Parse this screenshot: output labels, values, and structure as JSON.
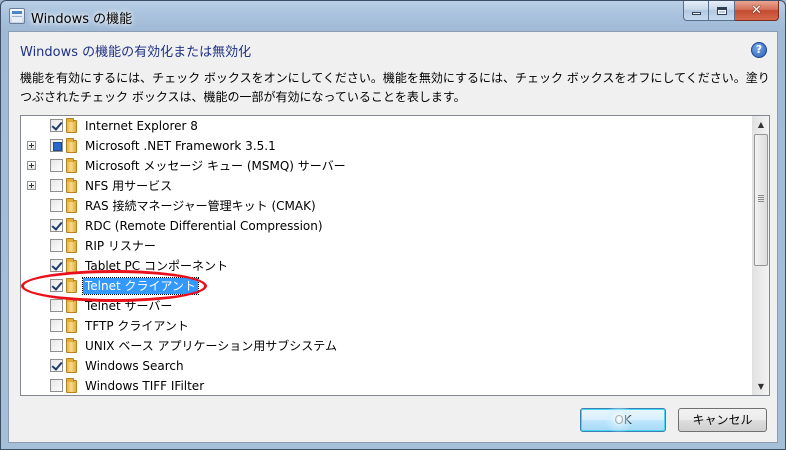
{
  "window": {
    "title": "Windows の機能"
  },
  "caption_buttons": {
    "minimize_icon": "minimize-icon",
    "maximize_icon": "maximize-icon",
    "close_icon": "close-icon",
    "close_glyph": "✕"
  },
  "dialog": {
    "heading": "Windows の機能の有効化または無効化",
    "help_glyph": "?",
    "description": "機能を有効にするには、チェック ボックスをオンにしてください。機能を無効にするには、チェック ボックスをオフにしてください。塗りつぶされたチェック ボックスは、機能の一部が有効になっていることを表します。"
  },
  "features": [
    {
      "label": "Internet Explorer 8",
      "state": "checked",
      "expandable": false
    },
    {
      "label": "Microsoft .NET Framework 3.5.1",
      "state": "partial",
      "expandable": true
    },
    {
      "label": "Microsoft メッセージ キュー (MSMQ) サーバー",
      "state": "unchecked",
      "expandable": true
    },
    {
      "label": "NFS 用サービス",
      "state": "unchecked",
      "expandable": true
    },
    {
      "label": "RAS 接続マネージャー管理キット (CMAK)",
      "state": "unchecked",
      "expandable": false
    },
    {
      "label": "RDC (Remote Differential Compression)",
      "state": "checked",
      "expandable": false
    },
    {
      "label": "RIP リスナー",
      "state": "unchecked",
      "expandable": false
    },
    {
      "label": "Tablet PC コンポーネント",
      "state": "checked",
      "expandable": false
    },
    {
      "label": "Telnet クライアント",
      "state": "checked",
      "expandable": false,
      "selected": true
    },
    {
      "label": "Telnet サーバー",
      "state": "unchecked",
      "expandable": false
    },
    {
      "label": "TFTP クライアント",
      "state": "unchecked",
      "expandable": false
    },
    {
      "label": "UNIX ベース アプリケーション用サブシステム",
      "state": "unchecked",
      "expandable": false
    },
    {
      "label": "Windows Search",
      "state": "checked",
      "expandable": false
    },
    {
      "label": "Windows TIFF IFilter",
      "state": "unchecked",
      "expandable": false
    }
  ],
  "scrollbar": {
    "up_glyph": "▲",
    "down_glyph": "▼"
  },
  "buttons": {
    "ok": "OK",
    "cancel": "キャンセル"
  },
  "colors": {
    "heading": "#1e3287",
    "selection": "#3399ff",
    "annotation": "#e8101a"
  }
}
